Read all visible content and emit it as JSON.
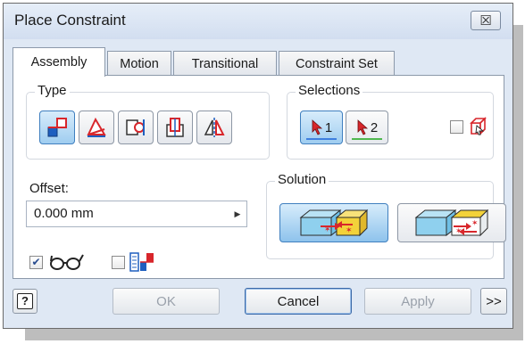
{
  "window": {
    "title": "Place Constraint",
    "close_glyph": "☒"
  },
  "tabs": [
    {
      "label": "Assembly",
      "active": true
    },
    {
      "label": "Motion",
      "active": false
    },
    {
      "label": "Transitional",
      "active": false
    },
    {
      "label": "Constraint Set",
      "active": false
    }
  ],
  "type_group": {
    "label": "Type",
    "buttons": [
      {
        "icon": "mate-icon",
        "active": true
      },
      {
        "icon": "angle-icon",
        "active": false
      },
      {
        "icon": "tangent-icon",
        "active": false
      },
      {
        "icon": "insert-icon",
        "active": false
      },
      {
        "icon": "symmetry-icon",
        "active": false
      }
    ]
  },
  "selections_group": {
    "label": "Selections",
    "select1": {
      "number": "1",
      "active": true,
      "underline_color": "#3f7fdf"
    },
    "select2": {
      "number": "2",
      "active": false,
      "underline_color": "#4fb84f"
    },
    "first_part_checked": false
  },
  "offset": {
    "label": "Offset:",
    "value": "0.000 mm",
    "spin_glyph": "▶"
  },
  "solution_group": {
    "label": "Solution",
    "options": [
      {
        "name": "mate",
        "active": true
      },
      {
        "name": "flush",
        "active": false
      }
    ]
  },
  "options": {
    "show_preview_checked": true,
    "predict_offset_checked": false
  },
  "footer": {
    "help_glyph": "?",
    "ok_label": "OK",
    "cancel_label": "Cancel",
    "apply_label": "Apply",
    "more_label": ">>"
  },
  "colors": {
    "accent_blue": "#3f7fbf",
    "active_fill": "#9fcdf0",
    "icon_red": "#d8262b",
    "icon_blue": "#1f5fbf",
    "face_yellow": "#f3d23a"
  }
}
